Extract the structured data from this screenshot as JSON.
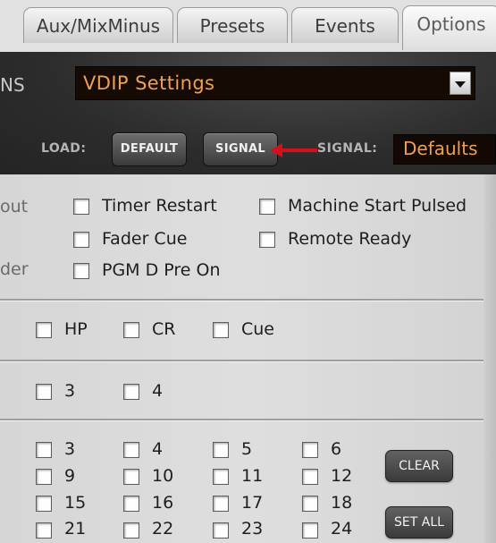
{
  "tabs": [
    {
      "label": "Aux/MixMinus"
    },
    {
      "label": "Presets"
    },
    {
      "label": "Events"
    },
    {
      "label": "Options"
    }
  ],
  "header": {
    "select_label_fragment": "NS",
    "dropdown_value": "VDIP Settings",
    "load_label": "LOAD:",
    "default_button": "DEFAULT",
    "signal_button": "SIGNAL",
    "signal_label": "SIGNAL:",
    "signal_value": "Defaults"
  },
  "options_section": {
    "cut_labels": [
      "out",
      "der"
    ],
    "items": [
      "Timer Restart",
      "Machine Start Pulsed",
      "Fader Cue",
      "Remote Ready",
      "PGM D Pre On"
    ]
  },
  "monitor_row": [
    "HP",
    "CR",
    "Cue"
  ],
  "channel_row": [
    "3",
    "4"
  ],
  "grid_rows": [
    [
      "3",
      "4",
      "5",
      "6"
    ],
    [
      "9",
      "10",
      "11",
      "12"
    ],
    [
      "15",
      "16",
      "17",
      "18"
    ],
    [
      "21",
      "22",
      "23",
      "24"
    ]
  ],
  "grid_buttons": {
    "clear": "CLEAR",
    "set_all": "SET ALL"
  },
  "colors": {
    "accent_text": "#f0a050",
    "annotation_arrow": "#d6101a",
    "panel_dark": "#2c2c2c"
  },
  "annotation": {
    "arrow_icon": "red-arrow-left"
  }
}
